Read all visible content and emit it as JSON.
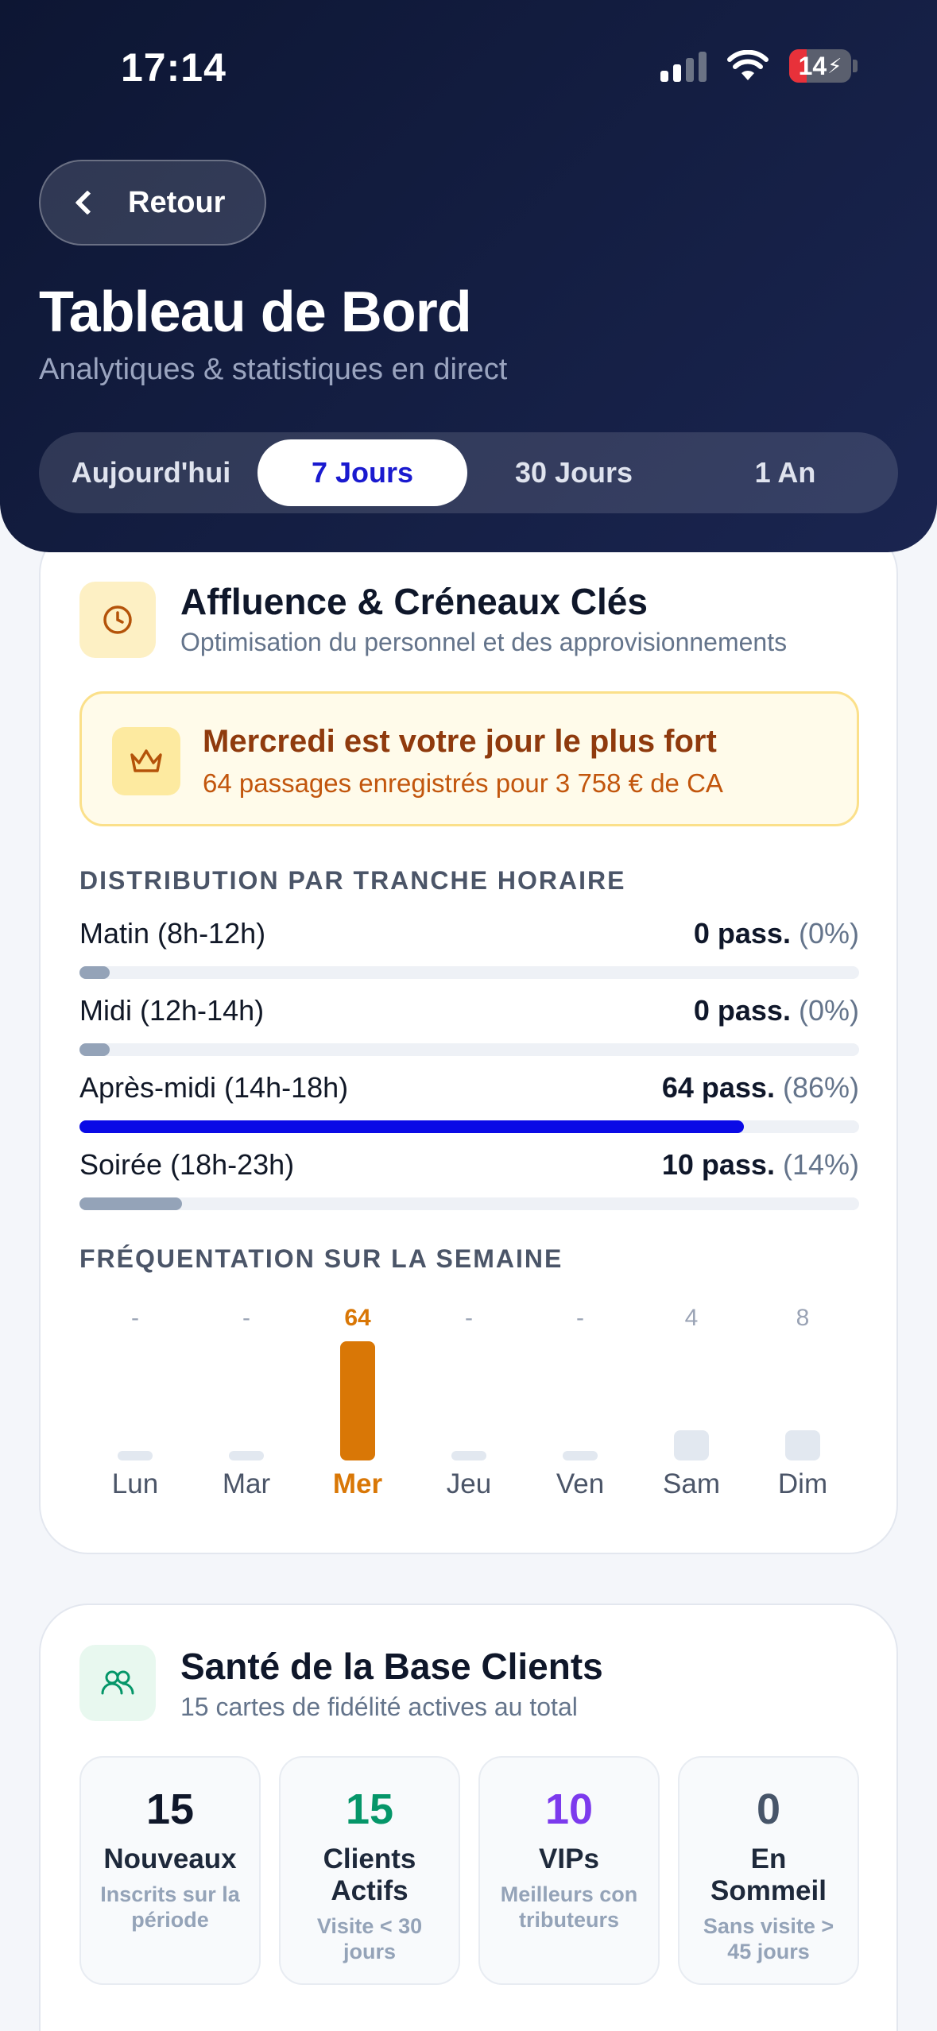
{
  "status_bar": {
    "time": "17:14",
    "battery": "14"
  },
  "header": {
    "back_label": "Retour",
    "title": "Tableau de Bord",
    "subtitle": "Analytiques & statistiques en direct",
    "tabs": [
      {
        "label": "Aujourd'hui",
        "active": false
      },
      {
        "label": "7 Jours",
        "active": true
      },
      {
        "label": "30 Jours",
        "active": false
      },
      {
        "label": "1 An",
        "active": false
      }
    ]
  },
  "affluence": {
    "icon": "clock-icon",
    "title": "Affluence & Créneaux Clés",
    "subtitle": "Optimisation du personnel et des approvisionnements",
    "highlight": {
      "icon": "crown-icon",
      "title": "Mercredi est votre jour le plus fort",
      "subtitle": "64 passages enregistrés pour 3 758 € de CA"
    },
    "distribution_title": "DISTRIBUTION PAR TRANCHE HORAIRE",
    "slots": [
      {
        "label": "Matin (8h-12h)",
        "value": "0 pass.",
        "pct": "(0%)",
        "fraction": 0.0,
        "color": "#94a3b8"
      },
      {
        "label": "Midi (12h-14h)",
        "value": "0 pass.",
        "pct": "(0%)",
        "fraction": 0.0,
        "color": "#94a3b8"
      },
      {
        "label": "Après-midi (14h-18h)",
        "value": "64 pass.",
        "pct": "(86%)",
        "fraction": 0.86,
        "color": "#0a0ae6"
      },
      {
        "label": "Soirée (18h-23h)",
        "value": "10 pass.",
        "pct": "(14%)",
        "fraction": 0.14,
        "color": "#94a3b8"
      }
    ],
    "week_title": "FRÉQUENTATION SUR LA SEMAINE",
    "week": [
      {
        "day": "Lun",
        "label": "-",
        "value": 0,
        "highlight": false
      },
      {
        "day": "Mar",
        "label": "-",
        "value": 0,
        "highlight": false
      },
      {
        "day": "Mer",
        "label": "64",
        "value": 64,
        "highlight": true
      },
      {
        "day": "Jeu",
        "label": "-",
        "value": 0,
        "highlight": false
      },
      {
        "day": "Ven",
        "label": "-",
        "value": 0,
        "highlight": false
      },
      {
        "day": "Sam",
        "label": "4",
        "value": 4,
        "highlight": false
      },
      {
        "day": "Dim",
        "label": "8",
        "value": 8,
        "highlight": false
      }
    ],
    "colors": {
      "accent": "#d97706",
      "muted": "#e2e8f0"
    }
  },
  "clients": {
    "icon": "users-icon",
    "title": "Santé de la Base Clients",
    "subtitle": "15 cartes de fidélité actives au total",
    "stats": [
      {
        "number": "15",
        "label": "Nouveaux",
        "desc": "Inscrits sur la période",
        "color": "#0f172a"
      },
      {
        "number": "15",
        "label": "Clients Actifs",
        "desc": "Visite < 30 jours",
        "color": "#059669"
      },
      {
        "number": "10",
        "label": "VIPs",
        "desc": "Meilleurs contributeurs",
        "color": "#7c3aed"
      },
      {
        "number": "0",
        "label": "En Sommeil",
        "desc": "Sans visite > 45 jours",
        "color": "#475569"
      }
    ]
  }
}
